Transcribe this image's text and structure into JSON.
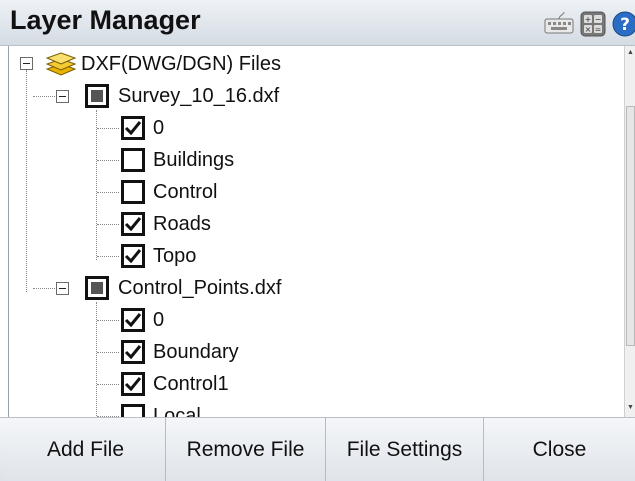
{
  "window": {
    "title": "Layer Manager",
    "icons": [
      "keyboard-icon",
      "calculator-icon",
      "help-icon"
    ]
  },
  "tree": {
    "root": {
      "label": "DXF(DWG/DGN) Files",
      "icon": "layers-icon",
      "expanded": true
    },
    "files": [
      {
        "label": "Survey_10_16.dxf",
        "state": "indeterminate",
        "expanded": true,
        "layers": [
          {
            "label": "0",
            "checked": true
          },
          {
            "label": "Buildings",
            "checked": false
          },
          {
            "label": "Control",
            "checked": false
          },
          {
            "label": "Roads",
            "checked": true
          },
          {
            "label": "Topo",
            "checked": true
          }
        ]
      },
      {
        "label": "Control_Points.dxf",
        "state": "indeterminate",
        "expanded": true,
        "layers": [
          {
            "label": "0",
            "checked": true
          },
          {
            "label": "Boundary",
            "checked": true
          },
          {
            "label": "Control1",
            "checked": true
          },
          {
            "label": "Local",
            "checked": false
          }
        ]
      }
    ]
  },
  "buttons": {
    "add_file": "Add File",
    "remove_file": "Remove File",
    "file_settings": "File Settings",
    "close": "Close"
  }
}
